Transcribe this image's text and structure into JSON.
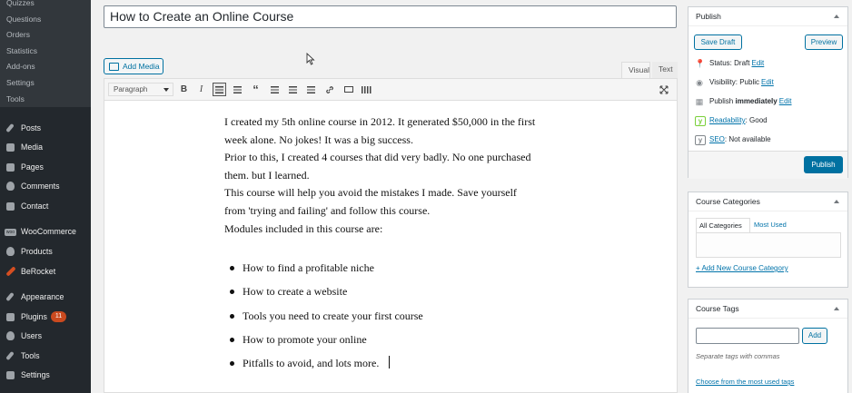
{
  "sidebar": {
    "submenu": [
      "Quizzes",
      "Questions",
      "Orders",
      "Statistics",
      "Add-ons",
      "Settings",
      "Tools"
    ],
    "menu": [
      {
        "label": "Posts",
        "icon": "pin-icon"
      },
      {
        "label": "Media",
        "icon": "media-icon"
      },
      {
        "label": "Pages",
        "icon": "pages-icon"
      },
      {
        "label": "Comments",
        "icon": "comments-icon"
      },
      {
        "label": "Contact",
        "icon": "mail-icon"
      },
      {
        "label": "WooCommerce",
        "icon": "woo-icon"
      },
      {
        "label": "Products",
        "icon": "products-icon"
      },
      {
        "label": "BeRocket",
        "icon": "rocket-icon"
      },
      {
        "label": "Appearance",
        "icon": "brush-icon"
      },
      {
        "label": "Plugins",
        "icon": "plugin-icon",
        "badge": "11"
      },
      {
        "label": "Users",
        "icon": "users-icon"
      },
      {
        "label": "Tools",
        "icon": "wrench-icon"
      },
      {
        "label": "Settings",
        "icon": "settings-icon"
      }
    ]
  },
  "editor": {
    "title": "How to Create an Online Course",
    "add_media": "Add Media",
    "tab_visual": "Visual",
    "tab_text": "Text",
    "format": "Paragraph",
    "paragraphs": [
      "I created my 5th online course in 2012. It generated $50,000 in the first",
      "week alone. No jokes! It was a big success.",
      "Prior to this, I created 4 courses that did very badly. No one purchased",
      "them. but I learned.",
      "This course will help you avoid the mistakes I made. Save yourself",
      "from 'trying and failing' and follow this course.",
      "Modules included in this course are:"
    ],
    "modules": [
      "How to find a profitable niche",
      "How to create a website",
      "Tools you need to create your first course",
      "How to promote your online",
      "Pitfalls to avoid, and lots more."
    ]
  },
  "publish": {
    "title": "Publish",
    "save_draft": "Save Draft",
    "preview": "Preview",
    "status_label": "Status:",
    "status_value": "Draft",
    "visibility_label": "Visibility:",
    "visibility_value": "Public",
    "publish_label": "Publish",
    "publish_value": "immediately",
    "edit": "Edit",
    "readability_link": "Readability",
    "readability_value": ": Good",
    "seo_link": "SEO",
    "seo_value": ": Not available",
    "publish_button": "Publish"
  },
  "categories": {
    "title": "Course Categories",
    "tab_all": "All Categories",
    "tab_used": "Most Used",
    "add_new": "+ Add New Course Category"
  },
  "tags": {
    "title": "Course Tags",
    "add": "Add",
    "hint": "Separate tags with commas",
    "choose": "Choose from the most used tags"
  }
}
